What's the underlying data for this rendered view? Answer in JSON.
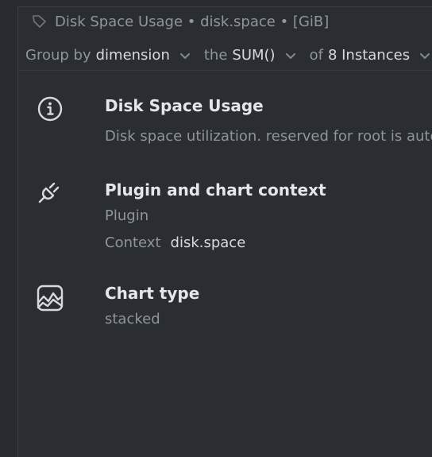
{
  "header": {
    "title": "Disk Space Usage • disk.space • [GiB]"
  },
  "group_by": {
    "group_label": "Group by",
    "group_value": "dimension",
    "agg_label": "the",
    "agg_value": "SUM()",
    "of_label": "of",
    "of_value": "8 Instances"
  },
  "info": {
    "title": "Disk Space Usage",
    "description": "Disk space utilization. reserved for root is automa"
  },
  "context": {
    "title": "Plugin and chart context",
    "plugin_label": "Plugin",
    "context_label": "Context",
    "context_value": "disk.space"
  },
  "chart_type": {
    "title": "Chart type",
    "value": "stacked"
  },
  "icons": {
    "title": "tag-icon",
    "chevron": "chevron-down-icon",
    "info": "info-icon",
    "plug": "plug-icon",
    "chart": "chart-icon"
  },
  "colors": {
    "background": "#272b30",
    "text_primary": "#e4e7ea",
    "text_secondary": "#8f959d"
  }
}
